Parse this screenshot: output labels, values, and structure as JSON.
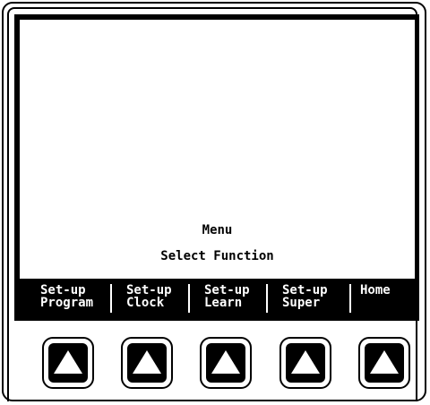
{
  "screen": {
    "title": "Menu",
    "subtitle": "Select Function"
  },
  "softkeys": [
    {
      "line1": "Set-up",
      "line2": "Program"
    },
    {
      "line1": "Set-up",
      "line2": "Clock"
    },
    {
      "line1": "Set-up",
      "line2": "Learn"
    },
    {
      "line1": "Set-up",
      "line2": "Super"
    },
    {
      "line1": "Home",
      "line2": ""
    }
  ],
  "buttons": [
    {
      "icon": "up-arrow-icon"
    },
    {
      "icon": "up-arrow-icon"
    },
    {
      "icon": "up-arrow-icon"
    },
    {
      "icon": "up-arrow-icon"
    },
    {
      "icon": "up-arrow-icon"
    }
  ],
  "colors": {
    "screen_bezel": "#000000",
    "screen_background": "#ffffff",
    "softkey_text": "#ffffff"
  }
}
